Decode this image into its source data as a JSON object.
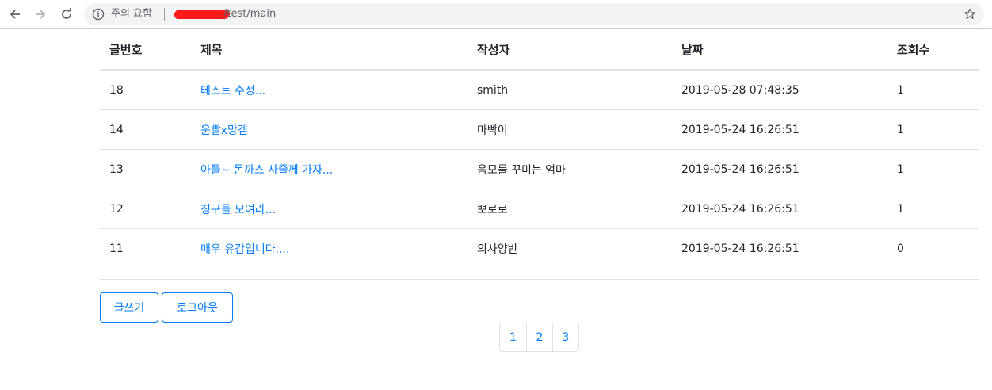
{
  "browser": {
    "security_label": "주의 요함",
    "url_path": "/test/main"
  },
  "table": {
    "headers": {
      "no": "글번호",
      "title": "제목",
      "writer": "작성자",
      "date": "날짜",
      "views": "조회수"
    },
    "rows": [
      {
        "no": "18",
        "title": "테스트 수정...",
        "writer": "smith",
        "date": "2019-05-28 07:48:35",
        "views": "1"
      },
      {
        "no": "14",
        "title": "운빨x망겜",
        "writer": "마빡이",
        "date": "2019-05-24 16:26:51",
        "views": "1"
      },
      {
        "no": "13",
        "title": "아들~ 돈까스 사줄께 가자...",
        "writer": "음모를 꾸미는 엄마",
        "date": "2019-05-24 16:26:51",
        "views": "1"
      },
      {
        "no": "12",
        "title": "칭구들 모여라...",
        "writer": "뽀로로",
        "date": "2019-05-24 16:26:51",
        "views": "1"
      },
      {
        "no": "11",
        "title": "매우 유감입니다....",
        "writer": "의사양반",
        "date": "2019-05-24 16:26:51",
        "views": "0"
      }
    ]
  },
  "actions": {
    "write_label": "글쓰기",
    "logout_label": "로그아웃"
  },
  "pagination": {
    "pages": [
      "1",
      "2",
      "3"
    ]
  },
  "colors": {
    "link": "#007bff",
    "border": "#dee2e6",
    "redaction": "#ff1a1a"
  }
}
